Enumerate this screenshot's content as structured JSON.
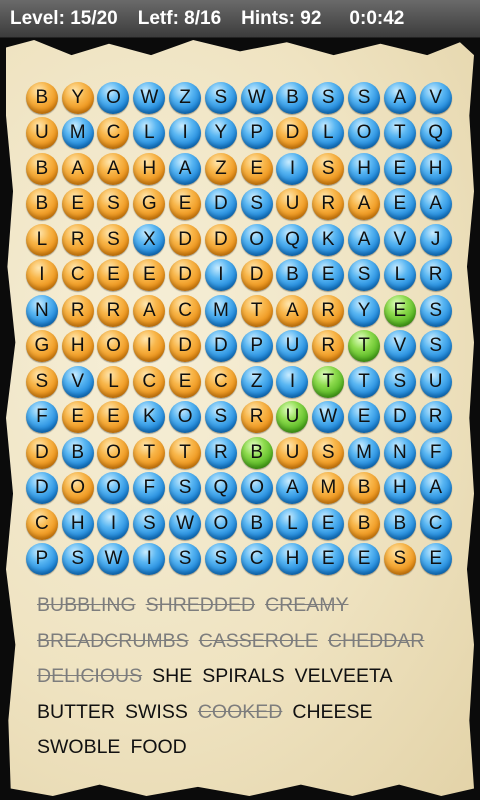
{
  "status": {
    "level": "Level: 15/20",
    "letf": "Letf: 8/16",
    "hints": "Hints: 92",
    "timer": "0:0:42"
  },
  "colors": {
    "blue": "#1480d8",
    "orange": "#ec8d10",
    "green": "#4db11b",
    "paper": "#efe3c1"
  },
  "grid": {
    "rows": [
      "BYOWZSWBSSAV",
      "UMCLIYPDLOTQ",
      "BAAHAZEISHEH",
      "BESGEDSURAEA",
      "LRSXDDOQKAVJ",
      "ICEEDIDBESLR",
      "NRRACMTARYES",
      "GHOIDDPURTVS",
      "SVLCECZITTSU",
      "FEEKOSRUWEDR",
      "DBOTTRBUSMNF",
      "DOOFSQOAMBHA",
      "CHISWOBLEBBC",
      "PSWISSCHEESE"
    ],
    "colors": [
      "ooBBBBBBBBBB",
      "oBoBBBBoBBBB",
      "ooooBooBoBBB",
      "oooooBBoooBB",
      "oooBooBBBBBB",
      "oooooBoBBBBB",
      "BooooBoooBgB",
      "oooooBBBoGBB",
      "oBooooBBgBBB",
      "BooBBBoGBBBB",
      "oBoooBgooBBB",
      "BoBBBBBBooBB",
      "oBBBBBBBBoBB",
      "BBBBBBBBBBoB"
    ]
  },
  "words": [
    {
      "text": "BUBBLING",
      "found": true
    },
    {
      "text": "SHREDDED",
      "found": true
    },
    {
      "text": "CREAMY",
      "found": true
    },
    {
      "text": "BREADCRUMBS",
      "found": true
    },
    {
      "text": "CASSEROLE",
      "found": true
    },
    {
      "text": "CHEDDAR",
      "found": true
    },
    {
      "text": "DELICIOUS",
      "found": true
    },
    {
      "text": "SHE",
      "found": false
    },
    {
      "text": "SPIRALS",
      "found": false
    },
    {
      "text": "VELVEETA",
      "found": false
    },
    {
      "text": "BUTTER",
      "found": false
    },
    {
      "text": "SWISS",
      "found": false
    },
    {
      "text": "COOKED",
      "found": true
    },
    {
      "text": "CHEESE",
      "found": false
    },
    {
      "text": "SWOBLE",
      "found": false
    },
    {
      "text": "FOOD",
      "found": false
    }
  ]
}
